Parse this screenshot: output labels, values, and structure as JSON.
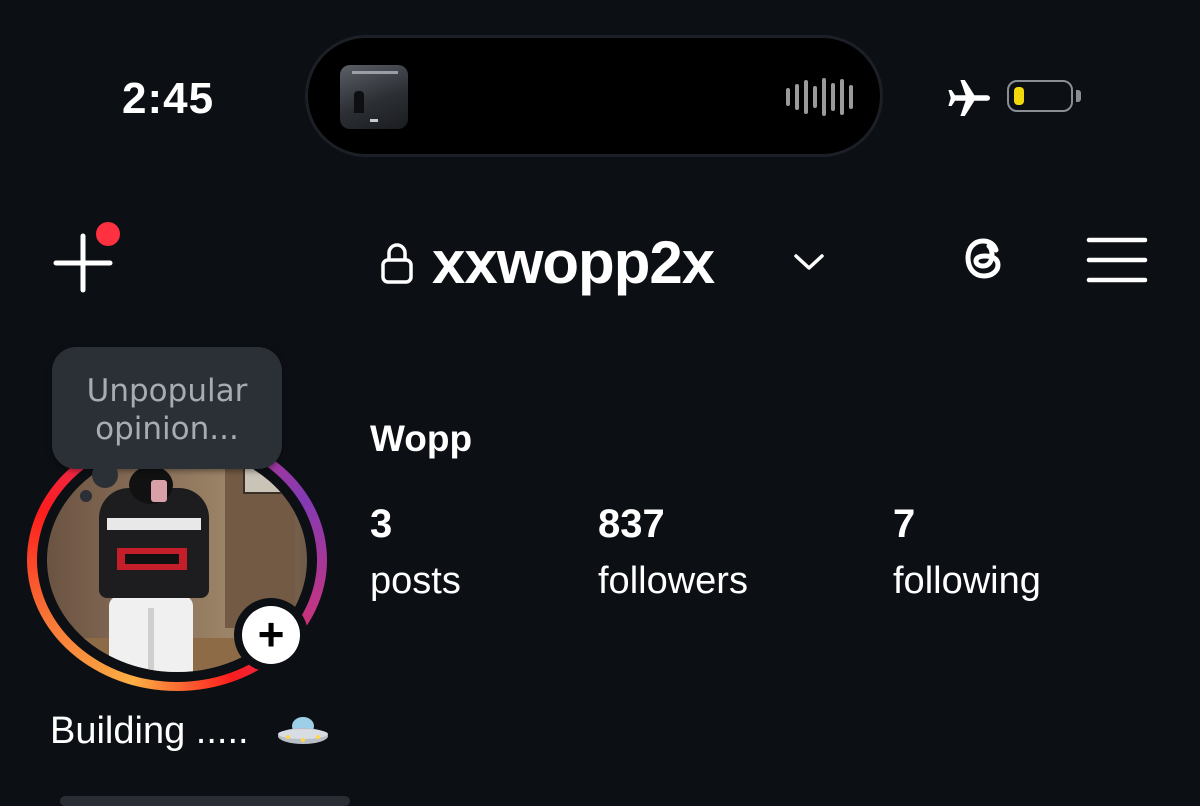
{
  "status_bar": {
    "time": "2:45",
    "battery_level": 0.1,
    "battery_color": "#f3d90c",
    "airplane_mode_icon": "airplane-icon"
  },
  "header": {
    "username": "xxwopp2x",
    "notification_dot_color": "#ff3040",
    "icons": [
      "plus-icon",
      "lock-icon",
      "chevron-down-icon",
      "threads-icon",
      "hamburger-menu-icon"
    ]
  },
  "note": {
    "text_line1": "Unpopular",
    "text_line2": "opinion..."
  },
  "profile": {
    "display_name": "Wopp",
    "stats": [
      {
        "value": "3",
        "label": "posts"
      },
      {
        "value": "837",
        "label": "followers"
      },
      {
        "value": "7",
        "label": "following"
      }
    ],
    "bio": "Building ....."
  },
  "colors": {
    "background": "#0c0f14",
    "text": "#ffffff",
    "note_bg": "#2b2f36",
    "note_text": "#a7abb2"
  }
}
